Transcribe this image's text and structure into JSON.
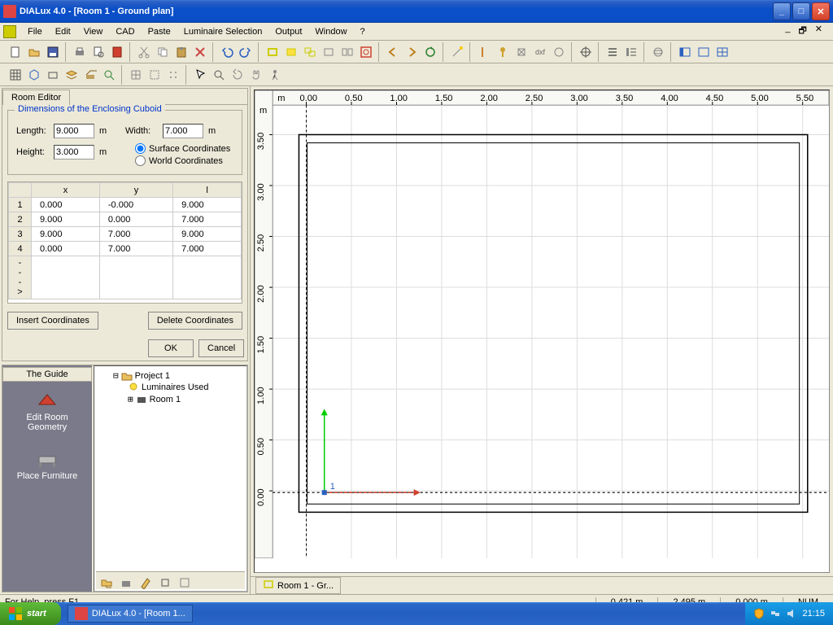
{
  "window": {
    "title": "DIALux 4.0 - [Room 1 - Ground plan]"
  },
  "menu": {
    "items": [
      "File",
      "Edit",
      "View",
      "CAD",
      "Paste",
      "Luminaire Selection",
      "Output",
      "Window",
      "?"
    ]
  },
  "roomEditor": {
    "tabLabel": "Room Editor",
    "groupTitle": "Dimensions of the Enclosing Cuboid",
    "lengthLabel": "Length:",
    "lengthValue": "9.000",
    "widthLabel": "Width:",
    "widthValue": "7.000",
    "heightLabel": "Height:",
    "heightValue": "3.000",
    "unit": "m",
    "surfaceCoords": "Surface Coordinates",
    "worldCoords": "World Coordinates",
    "coordCols": {
      "x": "x",
      "y": "y",
      "l": "l"
    },
    "coords": [
      {
        "n": "1",
        "x": "0.000",
        "y": "-0.000",
        "l": "9.000"
      },
      {
        "n": "2",
        "x": "9.000",
        "y": "0.000",
        "l": "7.000"
      },
      {
        "n": "3",
        "x": "9.000",
        "y": "7.000",
        "l": "9.000"
      },
      {
        "n": "4",
        "x": "0.000",
        "y": "7.000",
        "l": "7.000"
      }
    ],
    "arrowRow": "--->",
    "insertBtn": "Insert Coordinates",
    "deleteBtn": "Delete Coordinates",
    "okBtn": "OK",
    "cancelBtn": "Cancel"
  },
  "guide": {
    "title": "The Guide",
    "editRoom": "Edit Room Geometry",
    "placeFurniture": "Place Furniture"
  },
  "tree": {
    "project": "Project 1",
    "luminaires": "Luminaires Used",
    "room": "Room 1"
  },
  "drawing": {
    "rulerTicks": [
      "0.00",
      "0.50",
      "1.00",
      "1.50",
      "2.00",
      "2.50",
      "3.00",
      "3.50",
      "4.00",
      "4.50",
      "5.00",
      "5.50"
    ],
    "rulerYTicks": [
      "3.50",
      "3.00",
      "2.50",
      "2.00",
      "1.50",
      "1.00",
      "0.50",
      "0.00"
    ],
    "mUnit": "m",
    "pointLabel": "1",
    "tabLabel": "Room 1 - Gr..."
  },
  "status": {
    "help": "For Help, press F1.",
    "x": "0.421 m",
    "y": "2.495 m",
    "z": "0.000 m",
    "num": "NUM"
  },
  "taskbar": {
    "start": "start",
    "task": "DIALux 4.0 - [Room 1...",
    "clock": "21:15"
  }
}
